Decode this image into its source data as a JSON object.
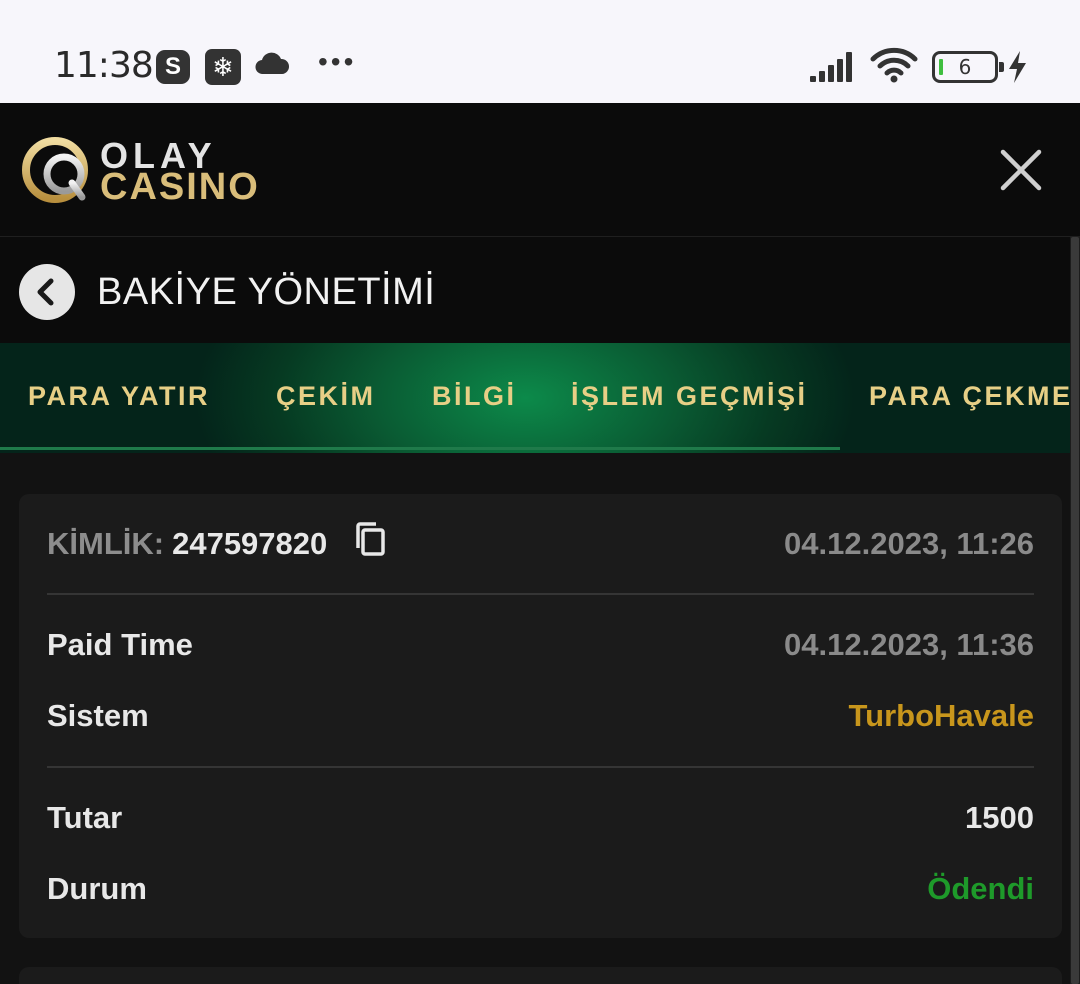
{
  "status_bar": {
    "time": "11:38",
    "battery_level": "6",
    "icons": [
      "skype-icon",
      "snowflake-icon",
      "cloud-icon",
      "more-dots-icon",
      "signal-icon",
      "wifi-icon",
      "battery-icon",
      "charging-bolt-icon"
    ]
  },
  "header": {
    "logo_text_top": "OLAY",
    "logo_text_bottom": "CASINO",
    "close_icon": "close-icon"
  },
  "page": {
    "title": "BAKİYE YÖNETİMİ",
    "back_icon": "chevron-left-icon"
  },
  "tabs": [
    {
      "label": "PARA YATIR"
    },
    {
      "label": "ÇEKİM"
    },
    {
      "label": "BİLGİ"
    },
    {
      "label": "İŞLEM GEÇMİŞİ"
    },
    {
      "label": "PARA ÇEKME"
    }
  ],
  "transaction": {
    "id_label": "KİMLİK:",
    "id_value": "247597820",
    "created": "04.12.2023, 11:26",
    "paid_time_label": "Paid Time",
    "paid_time_value": "04.12.2023, 11:36",
    "system_label": "Sistem",
    "system_value": "TurboHavale",
    "amount_label": "Tutar",
    "amount_value": "1500",
    "status_label": "Durum",
    "status_value": "Ödendi"
  },
  "colors": {
    "accent_gold": "#e7cf86",
    "system_gold": "#c8961c",
    "status_green": "#1e9a2a",
    "tab_green": "#0c8a4a"
  }
}
